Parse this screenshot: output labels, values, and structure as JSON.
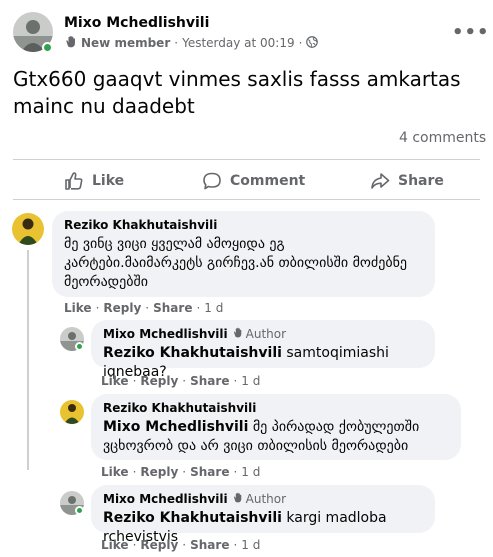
{
  "post": {
    "author": "Mixo Mchedlishvili",
    "badge": "New member",
    "time": "Yesterday at 00:19",
    "separator": "·",
    "more": "•••",
    "text": "Gtx660 gaaqvt vinmes saxlis fasss amkartas mainc nu daadebt",
    "comments_count": "4 comments"
  },
  "actions": {
    "like": "Like",
    "comment": "Comment",
    "share": "Share"
  },
  "comments": [
    {
      "author": "Reziko Khakhutaishvili",
      "text": "მე ვინც ვიცი ყველამ ამოყიდა ეგ კარტები.მაიმარკეტს გირჩევ.ან თბილისში მოძებნე მეორადებში",
      "like": "Like",
      "reply": "Reply",
      "share": "Share",
      "time": "1 d"
    },
    {
      "author": "Mixo Mchedlishvili",
      "tag": "Author",
      "mention": "Reziko Khakhutaishvili",
      "text": "samtoqimiashi iqnebaa?",
      "like": "Like",
      "reply": "Reply",
      "share": "Share",
      "time": "1 d"
    },
    {
      "author": "Reziko Khakhutaishvili",
      "mention": "Mixo Mchedlishvili",
      "text": "მე პირადად ქობულეთში ვცხოვრობ და არ ვიცი თბილისის მეორადები",
      "like": "Like",
      "reply": "Reply",
      "share": "Share",
      "time": "1 d"
    },
    {
      "author": "Mixo Mchedlishvili",
      "tag": "Author",
      "mention": "Reziko Khakhutaishvili",
      "text": "kargi madloba rchevistvis",
      "like": "Like",
      "reply": "Reply",
      "share": "Share",
      "time": "1 d"
    }
  ],
  "icons": {
    "badge": "new-member-hand-icon",
    "privacy": "globe-icon",
    "author_tag": "author-hand-icon",
    "like": "thumbs-up-icon",
    "comment": "comment-bubble-icon",
    "share": "share-arrow-icon"
  },
  "colors": {
    "online": "#31a24c",
    "secondary_text": "#65676b",
    "bubble": "#f0f2f5",
    "divider": "#ced0d4"
  }
}
